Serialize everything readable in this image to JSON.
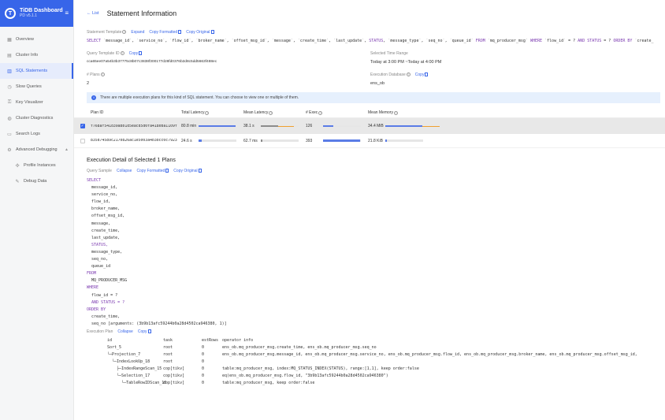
{
  "app": {
    "title": "TiDB Dashboard",
    "version": "PD v5.1.1"
  },
  "sidebar": {
    "items": [
      {
        "label": "Overview",
        "icon": "overview-icon"
      },
      {
        "label": "Cluster Info",
        "icon": "cluster-icon"
      },
      {
        "label": "SQL Statements",
        "icon": "sql-icon"
      },
      {
        "label": "Slow Queries",
        "icon": "slow-icon"
      },
      {
        "label": "Key Visualizer",
        "icon": "key-icon"
      },
      {
        "label": "Cluster Diagnostics",
        "icon": "diagnostics-icon"
      },
      {
        "label": "Search Logs",
        "icon": "logs-icon"
      },
      {
        "label": "Advanced Debugging",
        "icon": "debug-icon"
      },
      {
        "label": "Profile Instances",
        "icon": "profile-icon"
      },
      {
        "label": "Debug Data",
        "icon": "data-icon"
      }
    ]
  },
  "header": {
    "back": "List",
    "title": "Statement Information"
  },
  "template": {
    "label": "Statement Template",
    "expand": "Expand",
    "copy_formatted": "Copy Formatted",
    "copy_original": "Copy Original",
    "sql": [
      {
        "t": "SELECT",
        "k": true
      },
      {
        "t": " `message_id`, `service_no`, `flow_id`, `broker_name`, `offset_msg_id`, `message`, `create_time`, `last_update`, ",
        "k": false
      },
      {
        "t": "STATUS",
        "k": true
      },
      {
        "t": ", `message_type`, `seq_no`, `queue_id` ",
        "k": false
      },
      {
        "t": "FROM",
        "k": true
      },
      {
        "t": " `mq_producer_msg` ",
        "k": false
      },
      {
        "t": "WHERE",
        "k": true
      },
      {
        "t": " `flow_id` = ? ",
        "k": false
      },
      {
        "t": "AND",
        "k": true
      },
      {
        "t": " ",
        "k": false
      },
      {
        "t": "STATUS",
        "k": true
      },
      {
        "t": " = ? ",
        "k": false
      },
      {
        "t": "ORDER BY",
        "k": true
      },
      {
        "t": " `create_",
        "k": false
      }
    ]
  },
  "query_template_id": {
    "label": "Query Template ID",
    "copy": "Copy",
    "value": "cca65ee07a54b3b37775c8b07c3838f300177d28fd0376b2d8c5dd5663f488ec"
  },
  "time_range": {
    "label": "Selected Time Range",
    "value": "Today at 3:00 PM ~Today at 4:00 PM"
  },
  "plans": {
    "label": "# Plans",
    "value": "2"
  },
  "exec_db": {
    "label": "Execution Database",
    "copy": "Copy",
    "value": "ens_ob"
  },
  "banner": "There are multiple execution plans for this kind of SQL statement. You can choose to view one or multiple of them.",
  "plan_table": {
    "headers": {
      "plan_id": "Plan ID",
      "total_latency": "Total Latency",
      "mean_latency": "Mean Latency",
      "exec": "# Exec",
      "mean_memory": "Mean Memory"
    },
    "rows": [
      {
        "selected": true,
        "plan_id": "f768af541d39abb1d5eacd5d0fa4180ba1109f",
        "total_latency": "80.8 min",
        "total_frac": 0.98,
        "mean_latency": "38.1 s",
        "mean_frac": 0.45,
        "mean_tail": 0.42,
        "exec": "126",
        "exec_frac": 0.27,
        "mean_memory": "34.4 MiB",
        "mem_frac": 0.98,
        "mem_tail": 0.45
      },
      {
        "selected": false,
        "plan_id": "835d74589c2170826ac1e5003a4b3bcc0c7923",
        "total_latency": "24.6 s",
        "total_frac": 0.08,
        "mean_latency": "62.7 ms",
        "mean_frac": 0.04,
        "mean_tail": 0.0,
        "exec": "393",
        "exec_frac": 0.98,
        "mean_memory": "21.8 KiB",
        "mem_frac": 0.05,
        "mem_tail": 0.0
      }
    ]
  },
  "detail": {
    "title": "Execution Detail of Selected 1 Plans",
    "query_sample": "Query Sample",
    "collapse": "Collapse",
    "copy_formatted": "Copy Formatted",
    "copy_original": "Copy Original",
    "sql_lines": [
      {
        "t": "SELECT",
        "k": true
      },
      {
        "t": "  message_id,",
        "k": false
      },
      {
        "t": "  service_no,",
        "k": false
      },
      {
        "t": "  flow_id,",
        "k": false
      },
      {
        "t": "  broker_name,",
        "k": false
      },
      {
        "t": "  offset_msg_id,",
        "k": false
      },
      {
        "t": "  message,",
        "k": false
      },
      {
        "t": "  create_time,",
        "k": false
      },
      {
        "t": "  last_update,",
        "k": false
      },
      {
        "t": "  STATUS,",
        "k": true
      },
      {
        "t": "  message_type,",
        "k": false
      },
      {
        "t": "  seq_no,",
        "k": false
      },
      {
        "t": "  queue_id",
        "k": false
      },
      {
        "t": "FROM",
        "k": true
      },
      {
        "t": "  MQ_PRODUCER_MSG",
        "k": false
      },
      {
        "t": "WHERE",
        "k": true
      },
      {
        "t": "  flow_id = ?",
        "k": false
      },
      {
        "t": "  AND STATUS = ?",
        "k": true
      },
      {
        "t": "ORDER BY",
        "k": true
      },
      {
        "t": "  create_time,",
        "k": false
      },
      {
        "t": "  seq_no [arguments: (3b9b13afc59244b0a28d4502ca946380, 1)]",
        "k": false
      }
    ],
    "plan_label": "Execution Plan",
    "plan_collapse": "Collapse",
    "plan_copy": "Copy",
    "plan_rows": [
      {
        "id": "id",
        "task": "task",
        "rows": "estRows",
        "info": "operator info"
      },
      {
        "id": "Sort_5",
        "task": "root",
        "rows": "0",
        "info": "ens_ob.mq_producer_msg.create_time, ens_ob.mq_producer_msg.seq_no"
      },
      {
        "id": "└─Projection_7",
        "task": "root",
        "rows": "0",
        "info": "ens_ob.mq_producer_msg.message_id, ens_ob.mq_producer_msg.service_no, ens_ob.mq_producer_msg.flow_id, ens_ob.mq_producer_msg.broker_name, ens_ob.mq_producer_msg.offset_msg_id,"
      },
      {
        "id": "  └─IndexLookUp_18",
        "task": "root",
        "rows": "0",
        "info": ""
      },
      {
        "id": "    ├─IndexRangeScan_15",
        "task": "cop[tikv]",
        "rows": "0",
        "info": "table:mq_producer_msg, index:MQ_STATUS_INDEX(STATUS), range:[1,1], keep order:false"
      },
      {
        "id": "    └─Selection_17",
        "task": "cop[tikv]",
        "rows": "0",
        "info": "eq(ens_ob.mq_producer_msg.flow_id, \"3b9b13afc59244b0a28d4502ca946380\")"
      },
      {
        "id": "      └─TableRowIDScan_16",
        "task": "cop[tikv]",
        "rows": "0",
        "info": "table:mq_producer_msg, keep order:false"
      }
    ]
  }
}
